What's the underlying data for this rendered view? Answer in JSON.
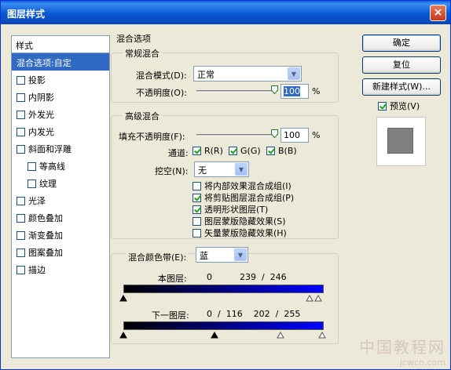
{
  "window": {
    "title": "图层样式",
    "close": "×"
  },
  "style_list": {
    "header": "样式",
    "items": [
      {
        "label": "混合选项:自定",
        "selected": true,
        "checkbox": false,
        "indent": false
      },
      {
        "label": "投影",
        "checkbox": true,
        "indent": false
      },
      {
        "label": "内阴影",
        "checkbox": true,
        "indent": false
      },
      {
        "label": "外发光",
        "checkbox": true,
        "indent": false
      },
      {
        "label": "内发光",
        "checkbox": true,
        "indent": false
      },
      {
        "label": "斜面和浮雕",
        "checkbox": true,
        "indent": false
      },
      {
        "label": "等高线",
        "checkbox": true,
        "indent": true
      },
      {
        "label": "纹理",
        "checkbox": true,
        "indent": true
      },
      {
        "label": "光泽",
        "checkbox": true,
        "indent": false
      },
      {
        "label": "颜色叠加",
        "checkbox": true,
        "indent": false
      },
      {
        "label": "渐变叠加",
        "checkbox": true,
        "indent": false
      },
      {
        "label": "图案叠加",
        "checkbox": true,
        "indent": false
      },
      {
        "label": "描边",
        "checkbox": true,
        "indent": false
      }
    ]
  },
  "blend_options": {
    "legend": "混合选项",
    "general": {
      "legend": "常规混合",
      "mode_label": "混合模式(D):",
      "mode_value": "正常",
      "opacity_label": "不透明度(O):",
      "opacity_value": "100",
      "unit": "%",
      "opacity_level": 100
    },
    "advanced": {
      "legend": "高级混合",
      "fill_label": "填充不透明度(F):",
      "fill_value": "100",
      "unit": "%",
      "fill_level": 100,
      "channels_label": "通道:",
      "channels": [
        {
          "label": "R(R)",
          "checked": true
        },
        {
          "label": "G(G)",
          "checked": true
        },
        {
          "label": "B(B)",
          "checked": true
        }
      ],
      "knockout_label": "挖空(N):",
      "knockout_value": "无",
      "options": [
        {
          "label": "将内部效果混合成组(I)",
          "checked": false
        },
        {
          "label": "将剪贴图层混合成组(P)",
          "checked": true
        },
        {
          "label": "透明形状图层(T)",
          "checked": true
        },
        {
          "label": "图层蒙版隐藏效果(S)",
          "checked": false
        },
        {
          "label": "矢量蒙版隐藏效果(H)",
          "checked": false
        }
      ]
    },
    "blend_if": {
      "label": "混合颜色带(E):",
      "value": "蓝",
      "this_layer_label": "本图层:",
      "this_layer_values": "0          239  /  246",
      "underlying_label": "下一图层:",
      "underlying_values": "0  /  116    202  /  255"
    }
  },
  "buttons": {
    "ok": "确定",
    "reset": "复位",
    "new_style": "新建样式(W)...",
    "preview_label": "预览(V)",
    "preview_checked": true
  },
  "watermark": {
    "text": "中国教程网",
    "url": "jcwcn.com"
  },
  "colors": {
    "accent": "#316ac5",
    "title_bar": "#0a58d0",
    "gradient_end": "#0000ff"
  }
}
